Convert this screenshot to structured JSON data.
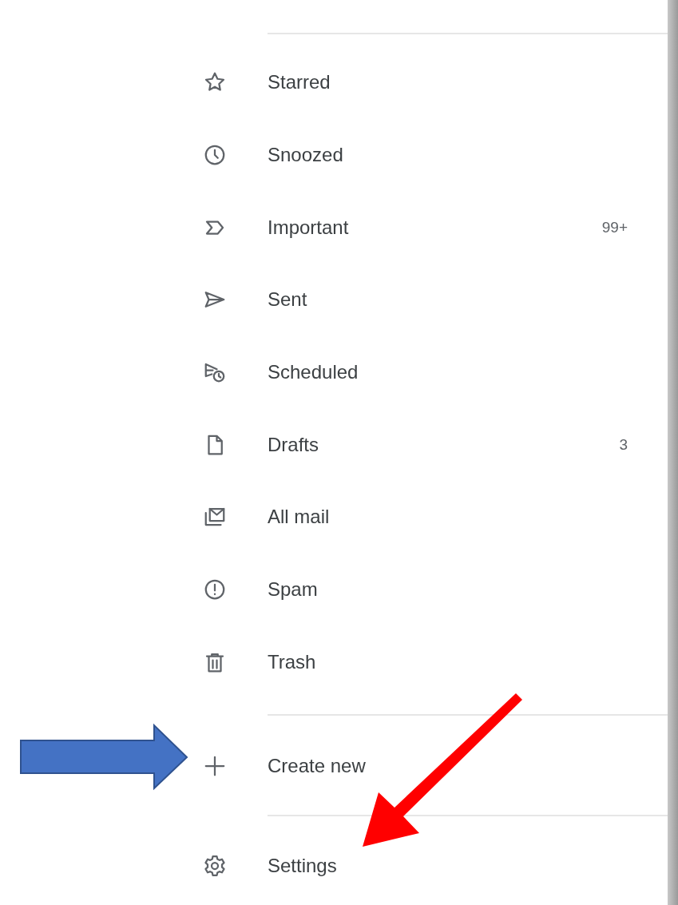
{
  "drawer": {
    "items": [
      {
        "label": "Starred"
      },
      {
        "label": "Snoozed"
      },
      {
        "label": "Important",
        "count": "99+"
      },
      {
        "label": "Sent"
      },
      {
        "label": "Scheduled"
      },
      {
        "label": "Drafts",
        "count": "3"
      },
      {
        "label": "All mail"
      },
      {
        "label": "Spam"
      },
      {
        "label": "Trash"
      }
    ],
    "create_new": {
      "label": "Create new"
    },
    "settings": {
      "label": "Settings"
    }
  }
}
